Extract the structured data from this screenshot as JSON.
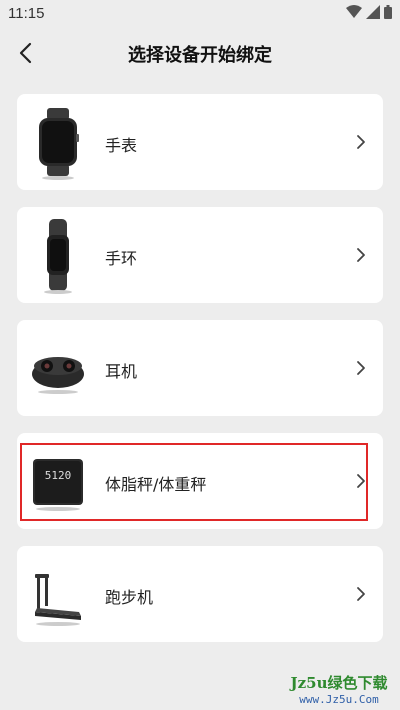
{
  "status_bar": {
    "time": "11:15",
    "icons": [
      "wifi-icon",
      "signal-icon",
      "battery-icon"
    ]
  },
  "header": {
    "title": "选择设备开始绑定",
    "back_icon": "chevron-left-icon"
  },
  "devices": [
    {
      "label": "手表",
      "icon": "watch-icon"
    },
    {
      "label": "手环",
      "icon": "band-icon"
    },
    {
      "label": "耳机",
      "icon": "earbuds-icon"
    },
    {
      "label": "体脂秤/体重秤",
      "icon": "scale-icon",
      "scale_display": "5120",
      "highlighted": true
    },
    {
      "label": "跑步机",
      "icon": "treadmill-icon"
    }
  ],
  "watermark": {
    "title": "Jz5u绿色下载",
    "url": "www.Jz5u.Com"
  },
  "colors": {
    "background": "#ededed",
    "card": "#ffffff",
    "highlight_border": "#e02828",
    "watermark_green": "#2f8a2f"
  }
}
